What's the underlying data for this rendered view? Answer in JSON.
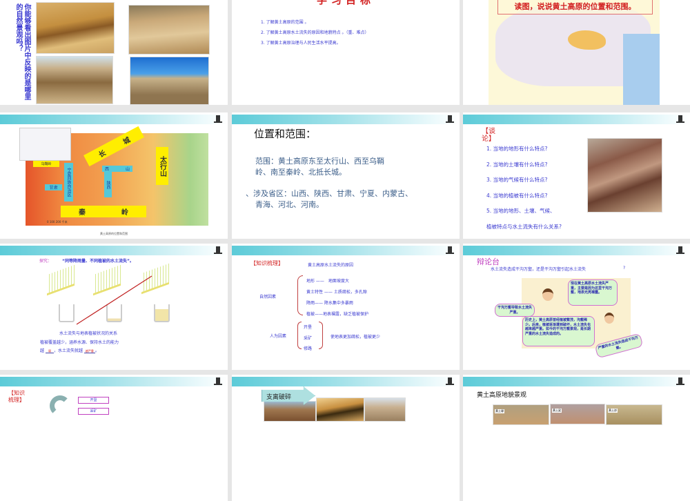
{
  "slides": [
    {
      "question": "你能够看出图片中反映的是哪里的自然景观吗？"
    },
    {
      "title": "学习目标",
      "items": [
        "1. 了解黄土高原的范围 。",
        "2. 了解黄土高原水土流失的原因和地貌特点 。（重、难点）",
        "3. 了解黄土高原治理与人民生活水平提高。"
      ]
    },
    {
      "title": "读图，说说黄土高原的位置和范围。"
    },
    {
      "labels": {
        "great_wall_1": "长",
        "great_wall_2": "城",
        "taihang": "太行山",
        "wushaoling": "乌鞘岭",
        "ningxia": "宁夏回族自治区",
        "gansu": "甘肃",
        "shanxi_1": "西",
        "shanxi_2": "山",
        "shaanxi": "陕西",
        "qinling_1": "秦",
        "qinling_2": "岭",
        "scale": "0 100 200 千米",
        "caption": "黄土高原的位置和范围"
      }
    },
    {
      "title": "位置和范围：",
      "range_1": "范围：黄土高原东至太行山、西至乌鞘",
      "range_2": "岭、南至秦岭、北抵长城。",
      "provinces_1": "、涉及省区：山西、陕西、甘肃、宁夏、内蒙古、",
      "provinces_2": "青海、河北、河南。"
    },
    {
      "heading": "【谈论】",
      "items": [
        "1. 当地的地形有什么特点?",
        "2. 当地的土壤有什么特点?",
        "3. 当地的气候有什么特点?",
        "4. 当地的植被有什么特点?",
        "5. 当地的地形、土壤、气候、"
      ],
      "last": "植被特点与水土流失有什么关系?"
    },
    {
      "label": "探究：",
      "title": "“同等降雨量、不同植被的水土流失”。",
      "line1": "水土流失与地表植被状况的关系",
      "line2": "植被覆盖越少，涵养水源、保持水土的能力",
      "line3a": "越",
      "blank1": "弱",
      "line3b": "，水土流失就越",
      "blank2": "越严重",
      "line3c": "。"
    },
    {
      "heading": "【知识梳理】",
      "title": "黄土高原水土流失的原因",
      "natural": "自然因素",
      "factors": [
        "地形 ——　地面坡度大",
        "黄土特性 —— 土质疏松，多孔隙",
        "降雨—— 降水集中多暴雨",
        "植被——地表裸露，缺乏植被保护"
      ],
      "human": "人为因素",
      "human_items": [
        "开垦",
        "采矿",
        "修路"
      ],
      "human_effect": "使地表更加疏松，植被更少"
    },
    {
      "heading": "辩论台",
      "question": "水土流失造成干沟万壑，还是干沟万壑引起水土流失",
      "qmark": "?",
      "b1": "现在黄土高原水土流失严重，主要是因为这里干沟万壑，地表光秃裸露。",
      "b2": "干沟万壑导致水土流失严重。",
      "b3": "历史上，黄土高原曾经植被繁茂，沟壑稀少。后来，植被逐渐遭到破坏，水土流失也越来越严重。如今的干沟万壑景观，是长期严重的水土流失造成的。",
      "b4": "严重的水土流失造成干沟万壑。"
    },
    {
      "heading": "【知识梳理】",
      "boxes": [
        "开垦",
        "采矿"
      ]
    },
    {
      "arrow": "支离破碎"
    },
    {
      "title": "黄土高原地貌景观",
      "photos": [
        "黄土塬",
        "黄土梁",
        "黄土峁"
      ]
    }
  ]
}
